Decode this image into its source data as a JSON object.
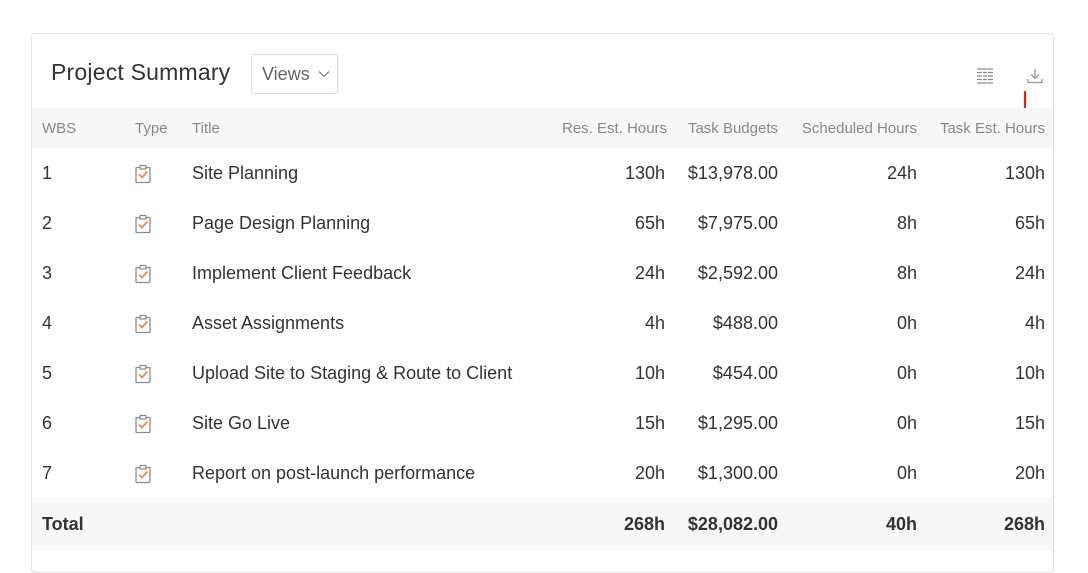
{
  "header": {
    "title": "Project Summary",
    "views_label": "Views"
  },
  "icons": {
    "columns": "columns-icon",
    "download": "download-icon",
    "task": "task-clipboard-icon",
    "annotation_arrow": "red-arrow-down-icon"
  },
  "colors": {
    "task_icon": "#e8894a",
    "annotation": "#e02020",
    "header_bg": "#f7f7f7"
  },
  "table": {
    "columns": {
      "wbs": "WBS",
      "type": "Type",
      "title": "Title",
      "res_est_hours": "Res. Est. Hours",
      "task_budgets": "Task Budgets",
      "scheduled_hours": "Scheduled Hours",
      "task_est_hours": "Task Est. Hours"
    },
    "rows": [
      {
        "wbs": "1",
        "title": "Site Planning",
        "res_est_hours": "130h",
        "task_budgets": "$13,978.00",
        "scheduled_hours": "24h",
        "task_est_hours": "130h"
      },
      {
        "wbs": "2",
        "title": "Page Design Planning",
        "res_est_hours": "65h",
        "task_budgets": "$7,975.00",
        "scheduled_hours": "8h",
        "task_est_hours": "65h"
      },
      {
        "wbs": "3",
        "title": "Implement Client Feedback",
        "res_est_hours": "24h",
        "task_budgets": "$2,592.00",
        "scheduled_hours": "8h",
        "task_est_hours": "24h"
      },
      {
        "wbs": "4",
        "title": "Asset Assignments",
        "res_est_hours": "4h",
        "task_budgets": "$488.00",
        "scheduled_hours": "0h",
        "task_est_hours": "4h"
      },
      {
        "wbs": "5",
        "title": "Upload Site to Staging & Route to Client",
        "res_est_hours": "10h",
        "task_budgets": "$454.00",
        "scheduled_hours": "0h",
        "task_est_hours": "10h"
      },
      {
        "wbs": "6",
        "title": "Site Go Live",
        "res_est_hours": "15h",
        "task_budgets": "$1,295.00",
        "scheduled_hours": "0h",
        "task_est_hours": "15h"
      },
      {
        "wbs": "7",
        "title": "Report on post-launch performance",
        "res_est_hours": "20h",
        "task_budgets": "$1,300.00",
        "scheduled_hours": "0h",
        "task_est_hours": "20h"
      }
    ],
    "total": {
      "label": "Total",
      "res_est_hours": "268h",
      "task_budgets": "$28,082.00",
      "scheduled_hours": "40h",
      "task_est_hours": "268h"
    }
  }
}
